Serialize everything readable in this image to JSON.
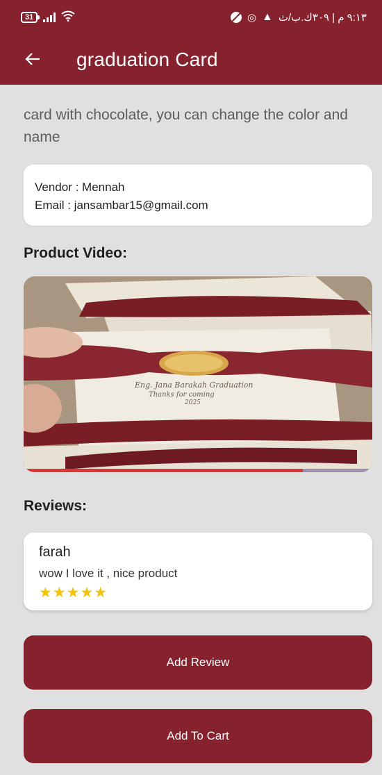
{
  "status_bar": {
    "battery": "31",
    "time_text": "٩:١٣ م | ٣٠٩ك.ب/ث"
  },
  "app_bar": {
    "back_icon": "arrow-left-icon",
    "title": "graduation Card"
  },
  "product": {
    "description": "card with chocolate, you can change the color and name",
    "vendor_line": "Vendor : Mennah",
    "email_line": "Email : jansambar15@gmail.com"
  },
  "video_section": {
    "heading": "Product Video:",
    "progress": 0.8,
    "card_text_line1": "Eng. Jana Barakah Graduation",
    "card_text_line2": "Thanks for coming",
    "card_text_line3": "2025"
  },
  "reviews_section": {
    "heading": "Reviews:",
    "items": [
      {
        "name": "farah",
        "text": "wow I love it , nice product",
        "rating": 5,
        "stars": "★★★★★"
      }
    ]
  },
  "buttons": {
    "add_review": "Add Review",
    "add_to_cart": "Add To Cart"
  },
  "colors": {
    "primary": "#85222d",
    "background": "#e0e0e0",
    "star": "#f4c20d"
  }
}
